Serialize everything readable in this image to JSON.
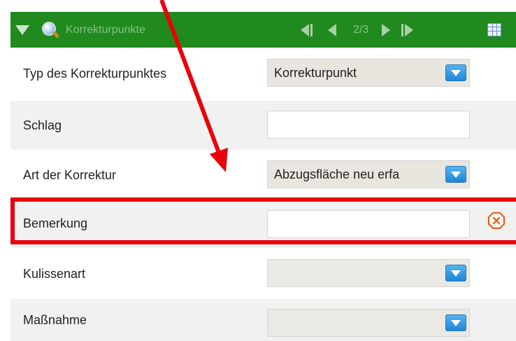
{
  "header": {
    "title": "Korrekturpunkte",
    "page_indicator": "2/3"
  },
  "rows": [
    {
      "label": "Typ des Korrekturpunktes",
      "type": "select",
      "value": "Korrekturpunkt"
    },
    {
      "label": "Schlag",
      "type": "text",
      "value": ""
    },
    {
      "label": "Art der Korrektur",
      "type": "select",
      "value": "Abzugsfläche neu erfa"
    },
    {
      "label": "Bemerkung",
      "type": "text",
      "value": ""
    },
    {
      "label": "Kulissenart",
      "type": "select",
      "value": ""
    },
    {
      "label": "Maßnahme",
      "type": "select",
      "value": ""
    }
  ],
  "icons": {
    "collapse": "triangle-down-icon",
    "search": "magnifier-icon",
    "first": "first-page-icon",
    "prev": "previous-page-icon",
    "next": "next-page-icon",
    "last": "last-page-icon",
    "table": "table-view-icon",
    "dropdown": "dropdown-arrow-icon",
    "clear": "clear-x-circle-icon"
  },
  "colors": {
    "header_bg": "#218a1f",
    "highlight": "#e8000b",
    "dropdown_button": "#1e86d8",
    "clear_icon": "#e05a1a"
  }
}
